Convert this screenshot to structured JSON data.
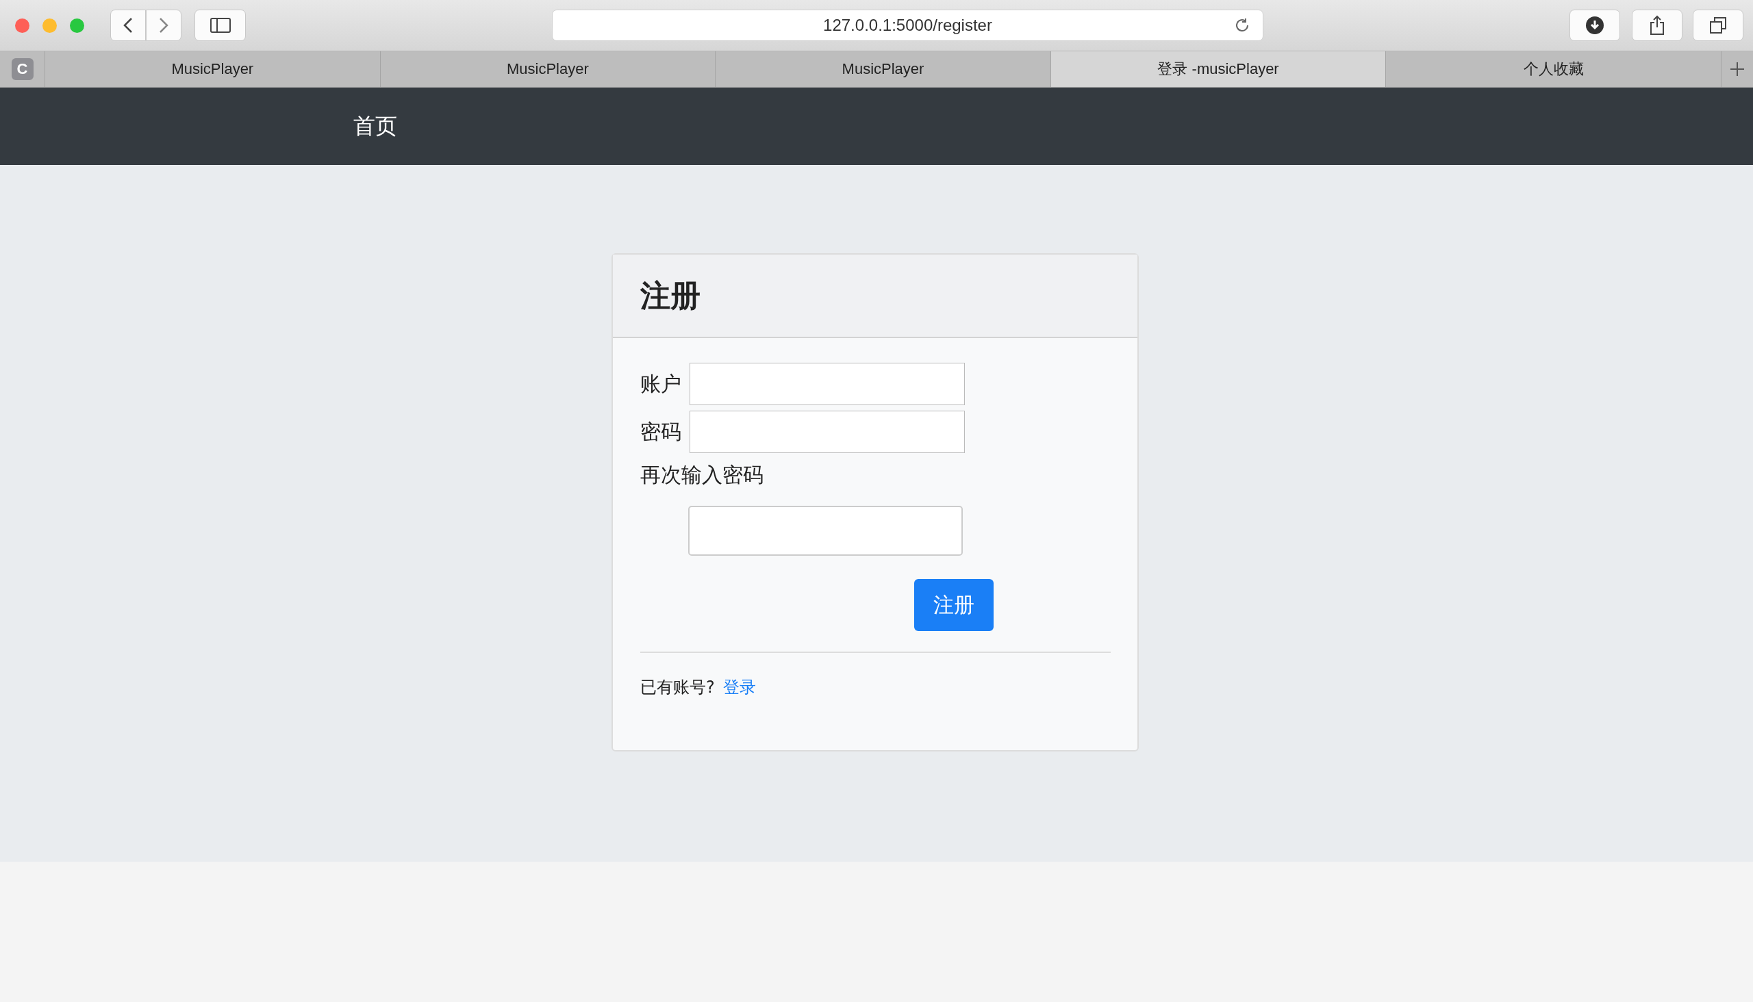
{
  "browser": {
    "url": "127.0.0.1:5000/register",
    "tab_group_letter": "C",
    "tabs": [
      {
        "label": "MusicPlayer",
        "selected": false
      },
      {
        "label": "MusicPlayer",
        "selected": false
      },
      {
        "label": "MusicPlayer",
        "selected": false
      },
      {
        "label": "登录 -musicPlayer",
        "selected": true
      },
      {
        "label": "个人收藏",
        "selected": false
      }
    ]
  },
  "navbar": {
    "home": "首页"
  },
  "card": {
    "title": "注册",
    "fields": [
      {
        "kind": "inline",
        "label": "账户"
      },
      {
        "kind": "inline",
        "label": "密码"
      },
      {
        "kind": "stacked",
        "label": "再次输入密码"
      }
    ],
    "submit": "注册",
    "footer": {
      "text": "已有账号?",
      "link": "登录"
    }
  }
}
